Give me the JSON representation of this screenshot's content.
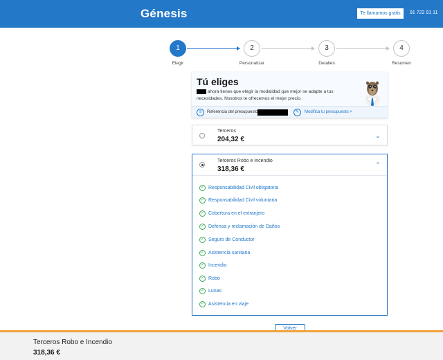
{
  "header": {
    "logo": "Génesis",
    "call_button": "Te llamamos gratis",
    "phone": "91 722 91 11"
  },
  "stepper": {
    "steps": [
      {
        "number": "1",
        "label": "Elegir",
        "active": true
      },
      {
        "number": "2",
        "label": "Personalizar",
        "active": false
      },
      {
        "number": "3",
        "label": "Detalles",
        "active": false
      },
      {
        "number": "4",
        "label": "Resumen",
        "active": false
      }
    ]
  },
  "intro": {
    "title": "Tú eliges",
    "text_line1": "ahora tienes que elegir la modalidad que mejor se adapte a tus",
    "text_line2": "necesidades. Nosotros te ofrecemos el mejor precio.",
    "reference_label": "Referencia del presupuesto:",
    "modify_link": "Modifica tu presupuesto >"
  },
  "options": [
    {
      "name": "Terceros",
      "price": "204,32 €",
      "selected": false,
      "expanded": false
    },
    {
      "name": "Terceros Robo e Incendio",
      "price": "318,36 €",
      "selected": true,
      "expanded": true,
      "coverages": [
        "Responsabilidad Civil obligatoria",
        "Responsabilidad Civil voluntaria",
        "Cobertura en el extranjero",
        "Defensa y reclamación de Daños",
        "Seguro de Conductor",
        "Asistencia sanitaria",
        "Incendio",
        "Robo",
        "Lunas",
        "Asistencia en viaje"
      ]
    }
  ],
  "back_button": "Volver",
  "footer": {
    "selected_name": "Terceros Robo e Incendio",
    "selected_price": "318,36 €"
  },
  "colors": {
    "brand_blue": "#2378c8",
    "check_green": "#3aaa5a",
    "footer_accent": "#f1a13a"
  }
}
